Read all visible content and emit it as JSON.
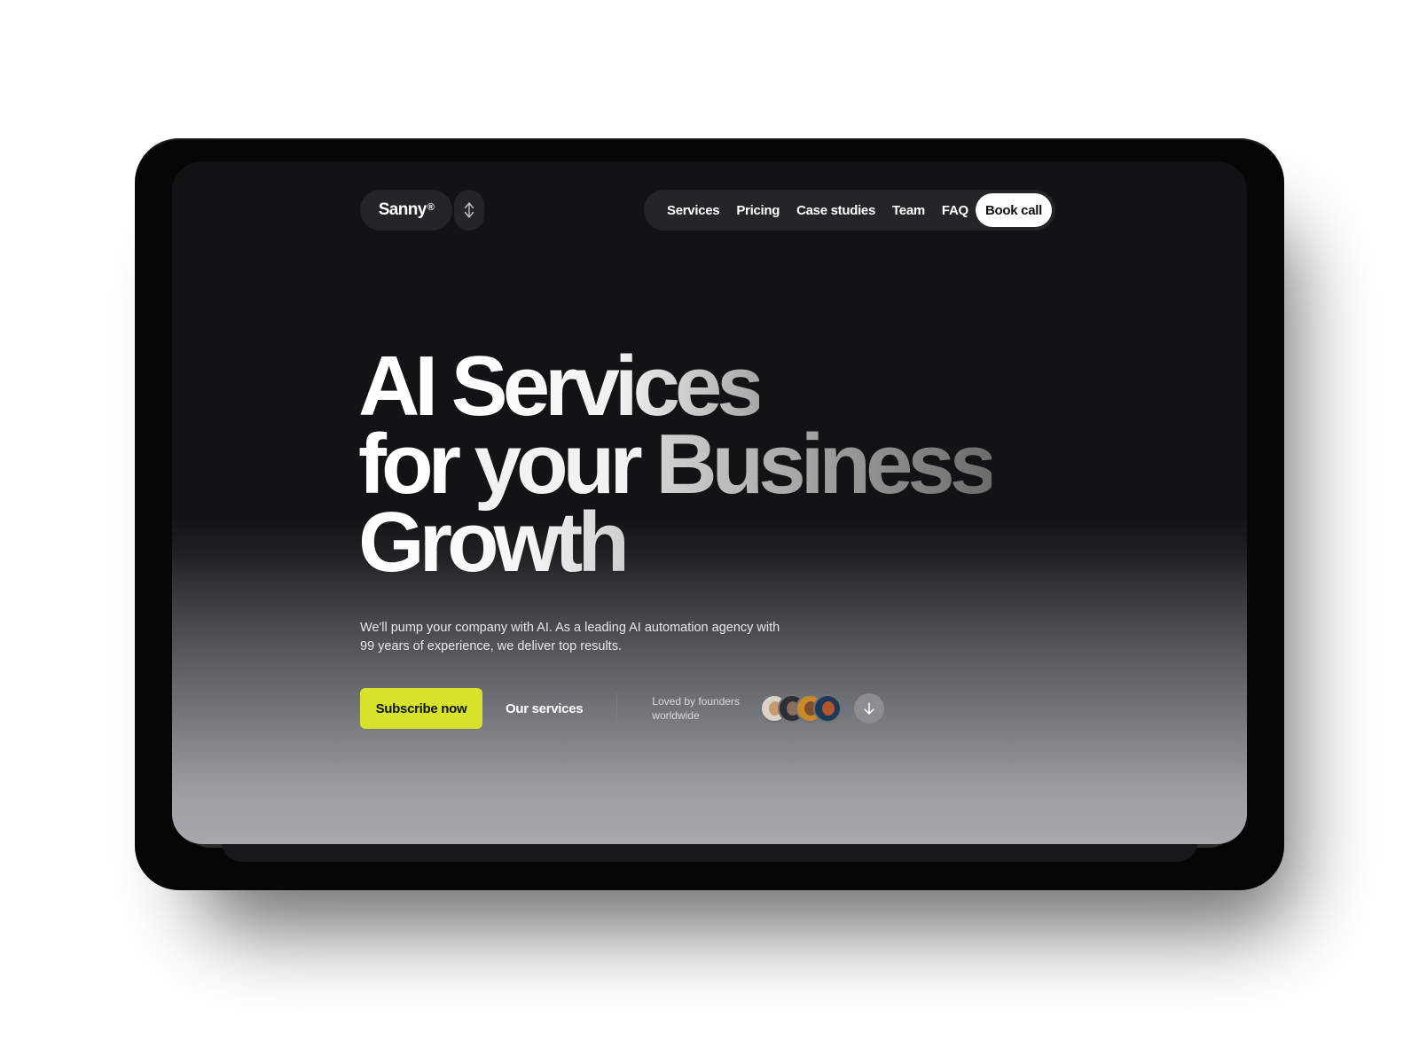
{
  "header": {
    "logo_text": "Sanny",
    "logo_mark": "®",
    "toggle_icon": "up-down-arrows-icon",
    "nav": [
      "Services",
      "Pricing",
      "Case studies",
      "Team",
      "FAQ"
    ],
    "cta_label": "Book call"
  },
  "hero": {
    "headline_words": [
      "AI",
      "Services",
      "for",
      "your",
      "Business",
      "Growth"
    ],
    "subtitle": "We'll pump your company with AI. As a leading AI automation agency with 99 years of experience, we deliver top results.",
    "primary_button": "Subscribe now",
    "secondary_link": "Our services",
    "social_proof": "Loved by founders worldwide",
    "avatar_count": 4,
    "scroll_icon": "arrow-down-icon"
  },
  "colors": {
    "accent": "#d6e32a",
    "screen_top": "#121315",
    "screen_bottom": "#a6a9ac",
    "pill_bg": "#232527",
    "device_frame": "#060606"
  }
}
